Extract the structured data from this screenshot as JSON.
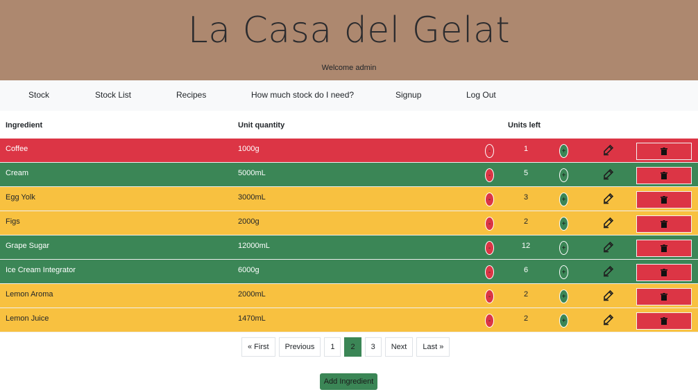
{
  "header": {
    "title": "La Casa del Gelat",
    "welcome": "Welcome admin"
  },
  "nav": [
    {
      "label": "Stock"
    },
    {
      "label": "Stock List"
    },
    {
      "label": "Recipes"
    },
    {
      "label": "How much stock do I need?"
    },
    {
      "label": "Signup"
    },
    {
      "label": "Log Out"
    }
  ],
  "table": {
    "headers": {
      "ingredient": "Ingredient",
      "unit_quantity": "Unit quantity",
      "units_left": "Units left"
    },
    "rows": [
      {
        "name": "Coffee",
        "qty": "1000g",
        "units": "1",
        "status": "red"
      },
      {
        "name": "Cream",
        "qty": "5000mL",
        "units": "5",
        "status": "green"
      },
      {
        "name": "Egg Yolk",
        "qty": "3000mL",
        "units": "3",
        "status": "yellow"
      },
      {
        "name": "Figs",
        "qty": "2000g",
        "units": "2",
        "status": "yellow"
      },
      {
        "name": "Grape Sugar",
        "qty": "12000mL",
        "units": "12",
        "status": "green"
      },
      {
        "name": "Ice Cream Integrator",
        "qty": "6000g",
        "units": "6",
        "status": "green"
      },
      {
        "name": "Lemon Aroma",
        "qty": "2000mL",
        "units": "2",
        "status": "yellow"
      },
      {
        "name": "Lemon Juice",
        "qty": "1470mL",
        "units": "2",
        "status": "yellow"
      }
    ],
    "minus_label": "-",
    "plus_label": "+"
  },
  "pagination": {
    "first": "« First",
    "previous": "Previous",
    "pages": [
      "1",
      "2",
      "3"
    ],
    "current": "2",
    "next": "Next",
    "last": "Last »"
  },
  "add_button": "Add Ingredient",
  "colors": {
    "header": "#ad886f",
    "red": "#dc3545",
    "green": "#3b8656",
    "yellow": "#f8c140"
  }
}
